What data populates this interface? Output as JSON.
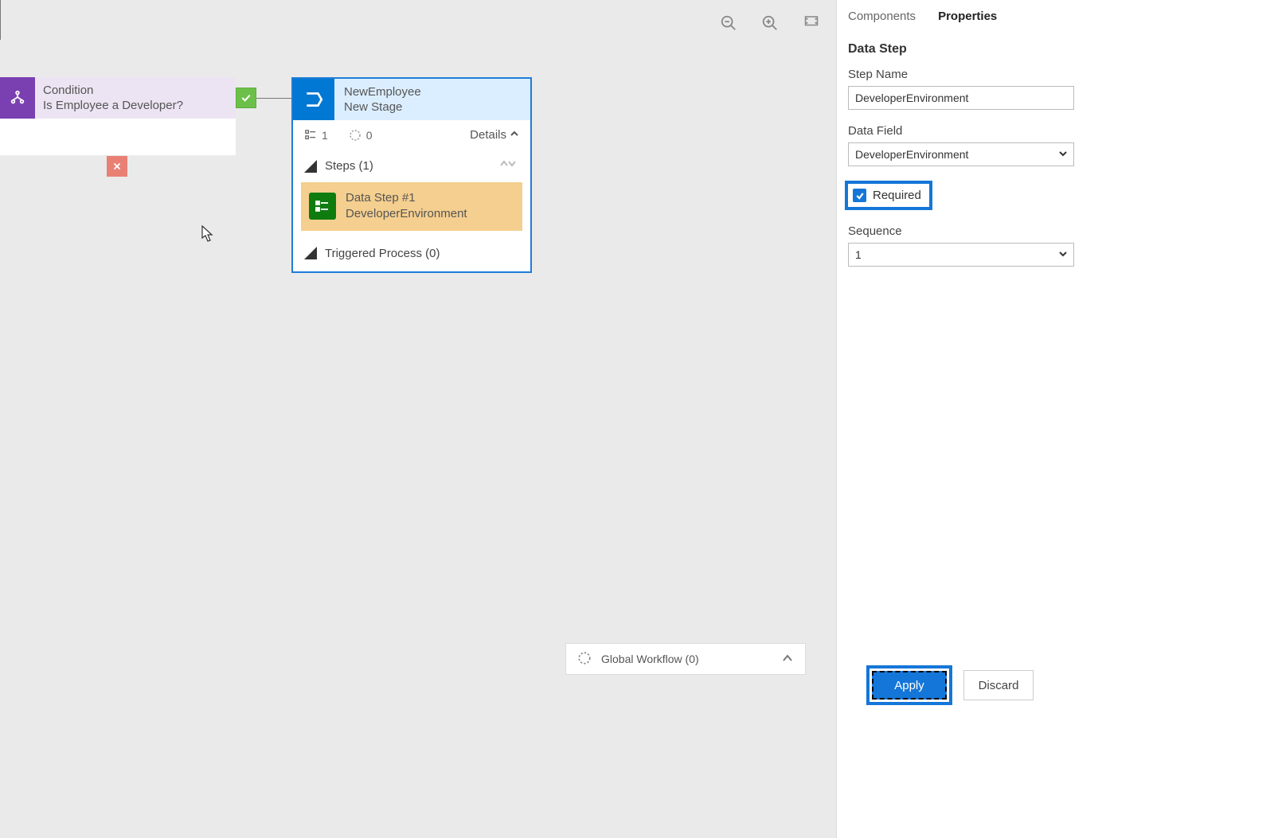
{
  "tabs": {
    "components": "Components",
    "properties": "Properties"
  },
  "panel": {
    "title": "Data Step",
    "stepNameLabel": "Step Name",
    "stepNameValue": "DeveloperEnvironment",
    "dataFieldLabel": "Data Field",
    "dataFieldValue": "DeveloperEnvironment",
    "requiredLabel": "Required",
    "sequenceLabel": "Sequence",
    "sequenceValue": "1",
    "applyLabel": "Apply",
    "discardLabel": "Discard"
  },
  "condition": {
    "label": "Condition",
    "text": "Is Employee a Developer?"
  },
  "stage": {
    "title": "NewEmployee",
    "subtitle": "New Stage",
    "countFields": "1",
    "countLoops": "0",
    "detailsLabel": "Details",
    "stepsLabel": "Steps (1)",
    "dataStepTitle": "Data Step #1",
    "dataStepSub": "DeveloperEnvironment",
    "triggeredLabel": "Triggered Process (0)"
  },
  "workflowBar": {
    "label": "Global Workflow (0)"
  }
}
